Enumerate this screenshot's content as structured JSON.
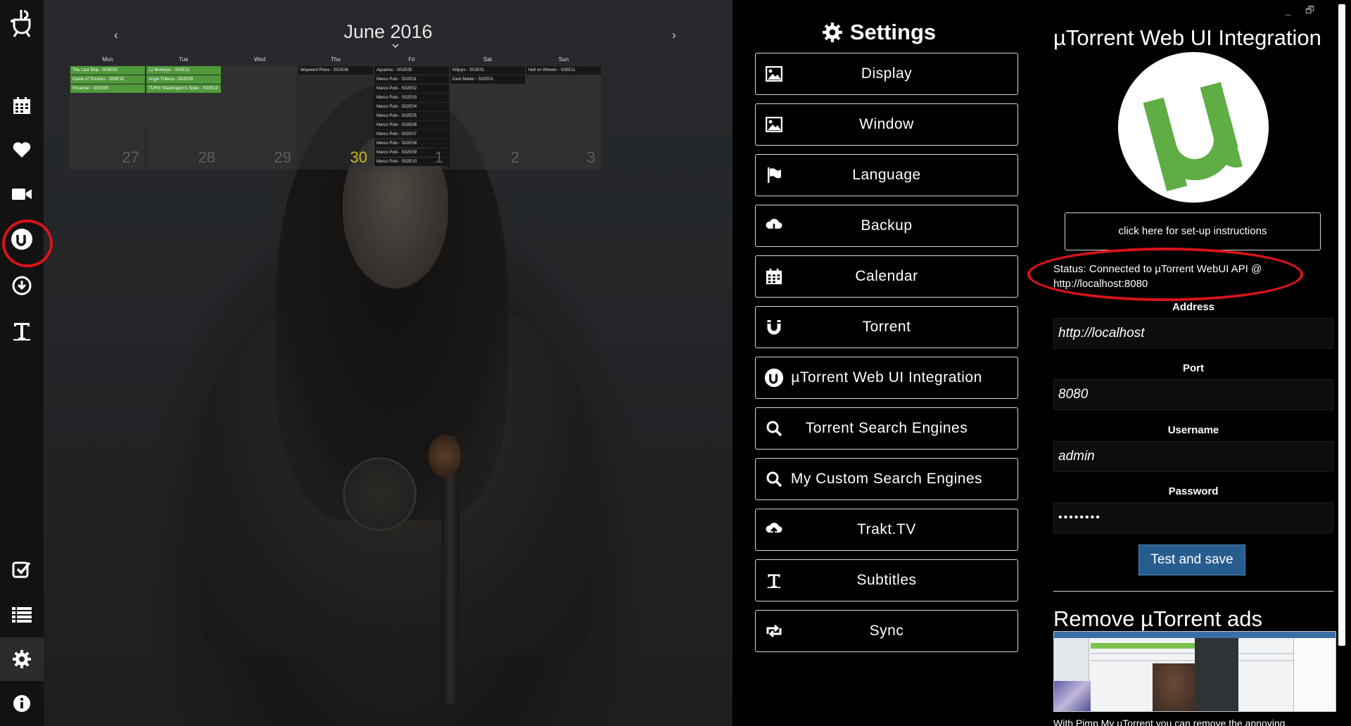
{
  "sidebar": {
    "icons": [
      "app-logo-icon",
      "calendar-icon",
      "heart-icon",
      "video-camera-icon",
      "utorrent-icon",
      "download-icon",
      "subtitles-icon",
      "checkmark-icon",
      "list-icon",
      "gear-icon",
      "info-icon"
    ],
    "active": "gear-icon",
    "highlighted": "utorrent-icon"
  },
  "calendar": {
    "title": "June 2016",
    "prev": "‹",
    "next": "›",
    "weekdays": [
      "Mon",
      "Tue",
      "Wed",
      "Thu",
      "Fri",
      "Sat",
      "Sun"
    ],
    "day_numbers": [
      "27",
      "28",
      "29",
      "30",
      "1",
      "2",
      "3"
    ],
    "today_index": 3,
    "events": [
      [
        "The Last Ship - S03E03",
        "Game of Thrones - S06E10",
        "Preacher - S01E05"
      ],
      [
        "12 Monkeys - S02E11",
        "Angie Tribeca - S02E05",
        "TURN: Washington's Spies - S03E10"
      ],
      [],
      [
        "Wayward Pines - S02E06"
      ],
      [
        "Aquarius - S02E05",
        "Marco Polo - S02E01",
        "Marco Polo - S02E02",
        "Marco Polo - S02E03",
        "Marco Polo - S02E04",
        "Marco Polo - S02E05",
        "Marco Polo - S02E06",
        "Marco Polo - S02E07",
        "Marco Polo - S02E08",
        "Marco Polo - S02E09",
        "Marco Polo - S02E10"
      ],
      [
        "Killjoys - S02E01",
        "Dark Matter - S02E01"
      ],
      [
        "Hell on Wheels - S05E11"
      ]
    ]
  },
  "settings": {
    "title": "Settings",
    "title_icon": "gear-icon",
    "items": [
      {
        "label": "Display",
        "icon": "image-icon"
      },
      {
        "label": "Window",
        "icon": "image-icon"
      },
      {
        "label": "Language",
        "icon": "flag-icon"
      },
      {
        "label": "Backup",
        "icon": "cloud-download-icon"
      },
      {
        "label": "Calendar",
        "icon": "calendar-icon"
      },
      {
        "label": "Torrent",
        "icon": "magnet-icon"
      },
      {
        "label": "µTorrent Web UI Integration",
        "icon": "utorrent-icon"
      },
      {
        "label": "Torrent Search Engines",
        "icon": "search-icon"
      },
      {
        "label": "My Custom Search Engines",
        "icon": "search-icon"
      },
      {
        "label": "Trakt.TV",
        "icon": "cloud-upload-icon"
      },
      {
        "label": "Subtitles",
        "icon": "text-icon"
      },
      {
        "label": "Sync",
        "icon": "sync-icon"
      }
    ]
  },
  "detail": {
    "title": "µTorrent Web UI Integration",
    "setup_button": "click here for set-up instructions",
    "status": "Status: Connected to µTorrent WebUI API @ http://localhost:8080",
    "fields": [
      {
        "label": "Address",
        "value": "http://localhost"
      },
      {
        "label": "Port",
        "value": "8080"
      },
      {
        "label": "Username",
        "value": "admin"
      },
      {
        "label": "Password",
        "value": "••••••••"
      }
    ],
    "save_button": "Test and save",
    "ads_title": "Remove µTorrent ads",
    "ads_caption": "With Pimp My µTorrent you can remove the annoying"
  },
  "window_controls": {
    "minimize": "_",
    "maximize": "🗗"
  },
  "colors": {
    "accent": "#275d8e",
    "highlight_ring": "#d8131b",
    "event_green": "#4f9a3a",
    "utorrent_green": "#5eae45"
  }
}
